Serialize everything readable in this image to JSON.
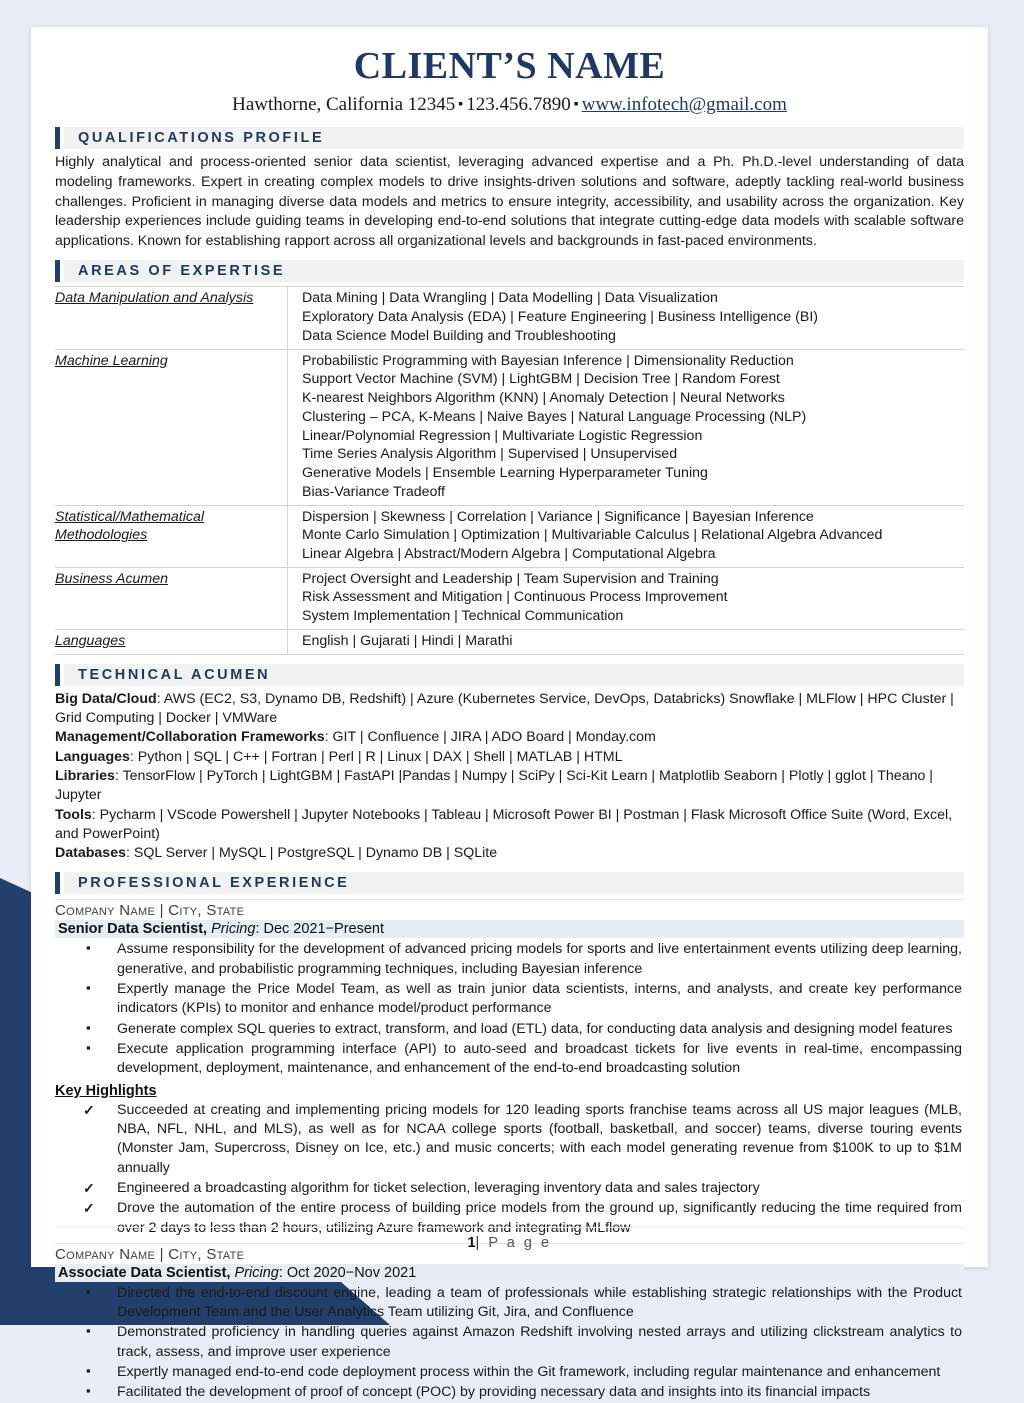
{
  "header": {
    "name": "CLIENT’S NAME",
    "location": "Hawthorne, California 12345",
    "phone": "123.456.7890",
    "email": "www.infotech@gmail.com",
    "separator": "▪"
  },
  "sections": {
    "qualifications": {
      "title": "QUALIFICATIONS PROFILE",
      "paragraph": "Highly analytical and process-oriented senior data scientist, leveraging advanced expertise and a Ph. Ph.D.-level understanding of data modeling frameworks. Expert in creating complex models to drive insights-driven solutions and software, adeptly tackling real-world business challenges. Proficient in managing diverse data models and metrics to ensure integrity, accessibility, and usability across the organization. Key leadership experiences include guiding teams in developing end-to-end solutions that integrate cutting-edge data models with scalable software applications. Known for establishing rapport across all organizational levels and backgrounds in fast-paced environments."
    },
    "areas_of_expertise": {
      "title": "AREAS OF EXPERTISE",
      "rows": [
        {
          "category": "Data Manipulation and Analysis",
          "lines": [
            "Data Mining | Data Wrangling | Data Modelling | Data Visualization",
            "Exploratory Data Analysis (EDA) | Feature Engineering | Business Intelligence (BI)",
            "Data Science Model Building and Troubleshooting"
          ]
        },
        {
          "category": "Machine Learning",
          "lines": [
            "Probabilistic Programming with Bayesian Inference | Dimensionality Reduction",
            "Support Vector Machine (SVM) | LightGBM | Decision Tree | Random Forest",
            "K-nearest Neighbors Algorithm (KNN) | Anomaly Detection | Neural Networks",
            "Clustering – PCA, K-Means | Naive Bayes | Natural Language Processing (NLP)",
            "Linear/Polynomial Regression | Multivariate Logistic Regression",
            "Time Series Analysis Algorithm | Supervised | Unsupervised",
            "Generative Models | Ensemble Learning Hyperparameter Tuning",
            "Bias-Variance Tradeoff"
          ]
        },
        {
          "category": "Statistical/Mathematical Methodologies",
          "lines": [
            "Dispersion | Skewness | Correlation | Variance | Significance | Bayesian Inference",
            "Monte Carlo Simulation | Optimization | Multivariable Calculus | Relational Algebra Advanced",
            "Linear Algebra | Abstract/Modern Algebra | Computational Algebra"
          ]
        },
        {
          "category": "Business Acumen",
          "lines": [
            "Project Oversight and Leadership | Team Supervision and Training",
            "Risk Assessment and Mitigation | Continuous Process Improvement",
            "System Implementation | Technical Communication"
          ]
        },
        {
          "category": "Languages",
          "lines": [
            "English | Gujarati | Hindi | Marathi"
          ]
        }
      ]
    },
    "technical_acumen": {
      "title": "TECHNICAL ACUMEN",
      "rows": [
        {
          "label": "Big Data/Cloud",
          "value": ": AWS (EC2, S3, Dynamo DB, Redshift) | Azure (Kubernetes Service, DevOps, Databricks) Snowflake | MLFlow | HPC Cluster | Grid Computing | Docker | VMWare"
        },
        {
          "label": "Management/Collaboration Frameworks",
          "value": ": GIT | Confluence | JIRA | ADO Board | Monday.com"
        },
        {
          "label": "Languages",
          "value": ": Python | SQL | C++ | Fortran | Perl | R | Linux | DAX | Shell | MATLAB | HTML"
        },
        {
          "label": "Libraries",
          "value": ": TensorFlow | PyTorch | LightGBM | FastAPI |Pandas | Numpy | SciPy | Sci-Kit Learn | Matplotlib Seaborn | Plotly | gglot | Theano | Jupyter"
        },
        {
          "label": "Tools",
          "value": ": Pycharm | VScode Powershell | Jupyter Notebooks | Tableau | Microsoft Power BI | Postman | Flask Microsoft Office Suite (Word, Excel, and PowerPoint)"
        },
        {
          "label": "Databases",
          "value": ": SQL Server | MySQL | PostgreSQL | Dynamo DB | SQLite"
        }
      ]
    },
    "professional_experience": {
      "title": "PROFESSIONAL EXPERIENCE",
      "jobs": [
        {
          "company_line": "Company Name | City, State",
          "title": "Senior Data Scientist,",
          "dept": " Pricing",
          "dates": ": Dec 2021−Present",
          "bullets": [
            "Assume responsibility for the development of advanced pricing models for sports and live entertainment events utilizing deep learning, generative, and probabilistic programming techniques, including Bayesian inference",
            "Expertly manage the Price Model Team, as well as train junior data scientists, interns, and analysts, and create key performance indicators (KPIs) to monitor and enhance model/product performance",
            "Generate complex SQL queries to extract, transform, and load (ETL) data, for conducting data analysis and designing model features",
            "Execute application programming interface (API) to auto-seed and broadcast tickets for live events in real-time, encompassing development, deployment, maintenance, and enhancement of the end-to-end broadcasting solution"
          ],
          "highlights_label": "Key Highlights",
          "highlights": [
            "Succeeded at creating and implementing pricing models for 120 leading sports franchise teams across all US major leagues (MLB, NBA, NFL, NHL, and MLS), as well as for NCAA college sports (football, basketball, and soccer) teams, diverse touring events (Monster Jam, Supercross, Disney on Ice, etc.) and music concerts; with each model generating revenue from $100K to up to $1M annually",
            "Engineered a broadcasting algorithm for ticket selection, leveraging inventory data and sales trajectory",
            "Drove the automation of the entire process of building price models from the ground up, significantly reducing the time required from over 2 days to less than 2 hours, utilizing Azure framework and integrating MLflow"
          ]
        },
        {
          "company_line": "Company Name | City, State",
          "title": "Associate Data Scientist,",
          "dept": " Pricing",
          "dates": ": Oct 2020−Nov 2021",
          "bullets": [
            "Directed the end-to-end discount engine, leading a team of professionals while establishing strategic relationships with the Product Development Team and the User Analytics Team utilizing Git, Jira, and Confluence",
            "Demonstrated proficiency in handling queries against Amazon Redshift involving nested arrays and utilizing clickstream analytics to track, assess, and improve user experience",
            "Expertly managed end-to-end code deployment process within the Git framework, including regular maintenance and enhancement",
            "Facilitated the development of proof of concept (POC) by providing necessary data and insights into its financial impacts"
          ],
          "highlights_label": "",
          "highlights": []
        }
      ]
    }
  },
  "footer": {
    "page_number": "1",
    "separator": "|",
    "label": "P a g e"
  },
  "colors": {
    "navy": "#233f6c",
    "heading_navy": "#1f3864",
    "page_bg": "#eaedf7",
    "band_gray": "#f2f2f2",
    "job_band": "#e8ecf4"
  }
}
